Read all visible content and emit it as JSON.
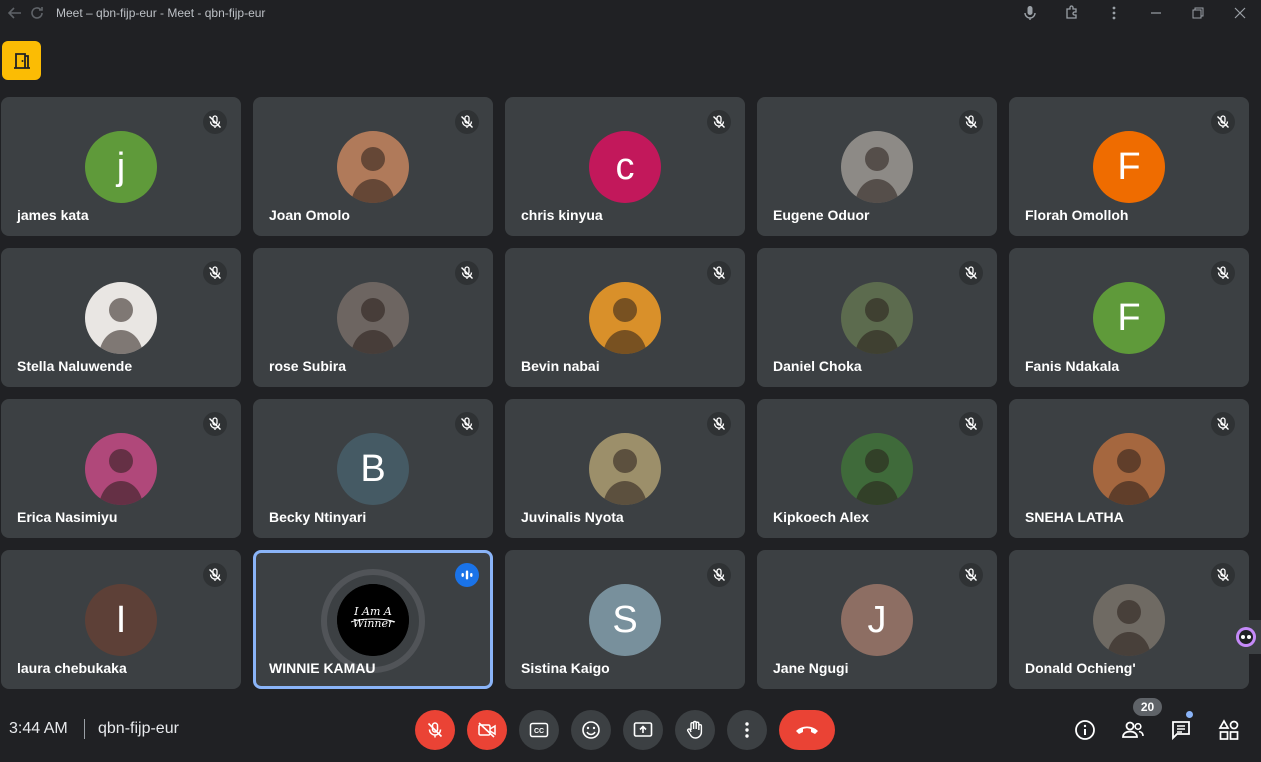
{
  "window": {
    "title": "Meet – qbn-fijp-eur - Meet - qbn-fijp-eur"
  },
  "participants": [
    {
      "name": "james kata",
      "initial": "j",
      "color": "#5f9a3a",
      "photo": false
    },
    {
      "name": "Joan Omolo",
      "initial": "",
      "color": "#b07a5a",
      "photo": true
    },
    {
      "name": "chris kinyua",
      "initial": "c",
      "color": "#c2185b",
      "photo": false
    },
    {
      "name": "Eugene Oduor",
      "initial": "",
      "color": "#8d8a86",
      "photo": true
    },
    {
      "name": "Florah Omolloh",
      "initial": "F",
      "color": "#ef6c00",
      "photo": false
    },
    {
      "name": "Stella Naluwende",
      "initial": "",
      "color": "#e9e6e3",
      "photo": true
    },
    {
      "name": "rose Subira",
      "initial": "",
      "color": "#6d6561",
      "photo": true
    },
    {
      "name": "Bevin nabai",
      "initial": "",
      "color": "#d9902a",
      "photo": true
    },
    {
      "name": "Daniel Choka",
      "initial": "",
      "color": "#5c6b4e",
      "photo": true
    },
    {
      "name": "Fanis Ndakala",
      "initial": "F",
      "color": "#5f9a3a",
      "photo": false
    },
    {
      "name": "Erica Nasimiyu",
      "initial": "",
      "color": "#b0487a",
      "photo": true
    },
    {
      "name": "Becky Ntinyari",
      "initial": "B",
      "color": "#455a64",
      "photo": false
    },
    {
      "name": "Juvinalis Nyota",
      "initial": "",
      "color": "#9c8f6a",
      "photo": true
    },
    {
      "name": "Kipkoech Alex",
      "initial": "",
      "color": "#3f6a3a",
      "photo": true
    },
    {
      "name": "SNEHA LATHA",
      "initial": "",
      "color": "#a5673f",
      "photo": true
    },
    {
      "name": "laura chebukaka",
      "initial": "I",
      "color": "#5d4037",
      "photo": false
    },
    {
      "name": "WINNIE KAMAU",
      "initial": "",
      "color": "#000000",
      "photo": true,
      "active": true,
      "badge_text": "I Am A Winner"
    },
    {
      "name": "Sistina Kaigo",
      "initial": "S",
      "color": "#78909c",
      "photo": false
    },
    {
      "name": "Jane Ngugi",
      "initial": "J",
      "color": "#8d6e63",
      "photo": false
    },
    {
      "name": "Donald Ochieng'",
      "initial": "",
      "color": "#6f6a63",
      "photo": true
    }
  ],
  "bottom_bar": {
    "time": "3:44 AM",
    "separator": "|",
    "meeting_code": "qbn-fijp-eur",
    "participant_count": "20"
  }
}
